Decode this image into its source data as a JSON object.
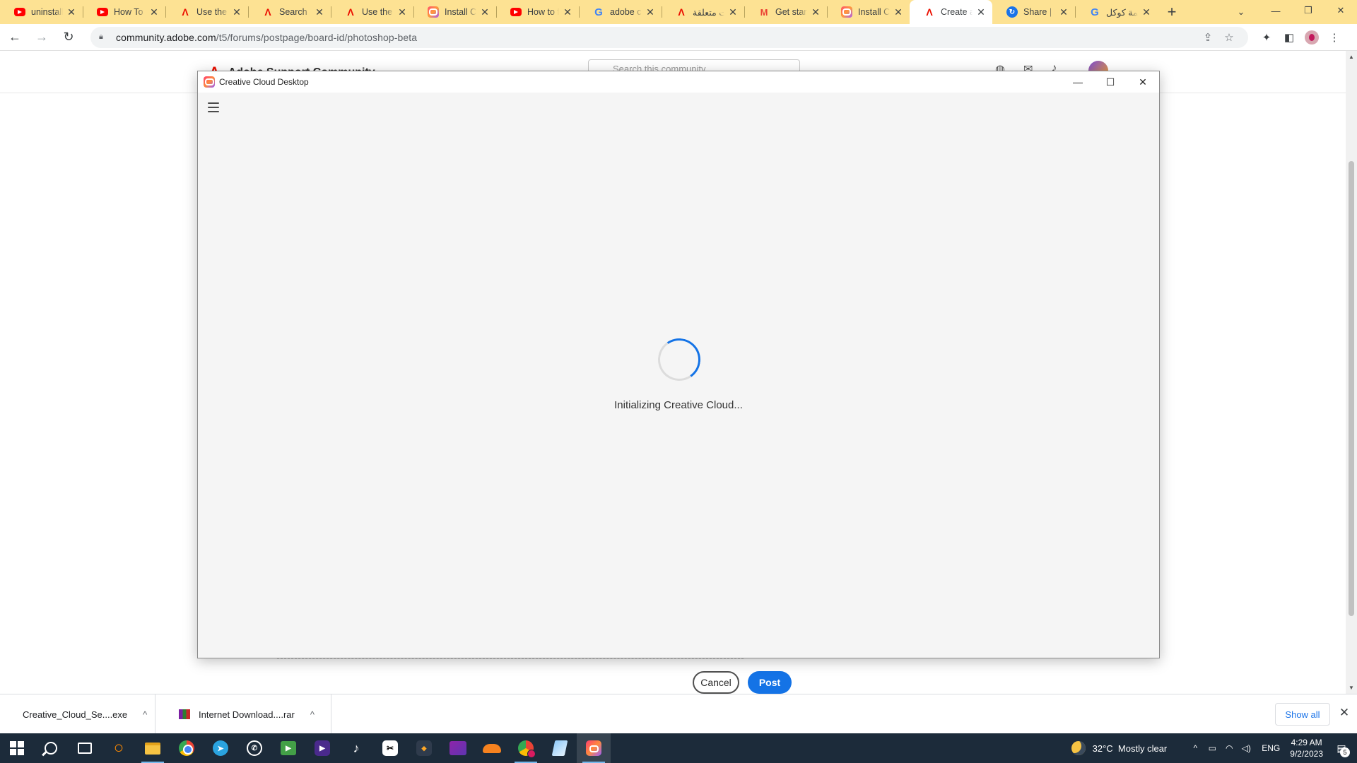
{
  "browser": {
    "tabs": [
      {
        "title": "uninstall a",
        "icon": "youtube-icon",
        "active": false
      },
      {
        "title": "How To U",
        "icon": "youtube-icon",
        "active": false
      },
      {
        "title": "Use the C",
        "icon": "adobe-icon",
        "active": false
      },
      {
        "title": "Search",
        "icon": "adobe-icon",
        "active": false
      },
      {
        "title": "Use the C",
        "icon": "adobe-icon",
        "active": false
      },
      {
        "title": "Install Cre",
        "icon": "creative-cloud-icon",
        "active": false
      },
      {
        "title": "How to fi",
        "icon": "youtube-icon",
        "active": false
      },
      {
        "title": "adobe cre",
        "icon": "google-icon",
        "active": false
      },
      {
        "title": "مشكلات متعلقة",
        "icon": "adobe-icon",
        "active": false
      },
      {
        "title": "Get starte",
        "icon": "gmail-icon",
        "active": false
      },
      {
        "title": "Install Cre",
        "icon": "creative-cloud-icon",
        "active": false
      },
      {
        "title": "Create a p",
        "icon": "adobe-icon",
        "active": true
      },
      {
        "title": "Share | In",
        "icon": "share-icon",
        "active": false
      },
      {
        "title": "ترجمة كوكل",
        "icon": "google-icon",
        "active": false
      }
    ],
    "address": {
      "host": "community.adobe.com",
      "path": "/t5/forums/postpage/board-id/photoshop-beta"
    }
  },
  "page": {
    "site_name": "Adobe Support Community",
    "search_placeholder": "Search this community",
    "cancel_label": "Cancel",
    "post_label": "Post"
  },
  "cc_window": {
    "title": "Creative Cloud Desktop",
    "status": "Initializing Creative Cloud..."
  },
  "downloads": {
    "items": [
      {
        "name": "Creative_Cloud_Se....exe",
        "icon": "creative-cloud-installer-icon"
      },
      {
        "name": "Internet Download....rar",
        "icon": "rar-archive-icon"
      }
    ],
    "show_all_label": "Show all"
  },
  "taskbar": {
    "weather": {
      "temp": "32°C",
      "condition": "Mostly clear"
    },
    "language": "ENG",
    "time": "4:29 AM",
    "date": "9/2/2023",
    "notification_count": "5"
  },
  "colors": {
    "tabstrip": "#fde293",
    "accent_blue": "#1473e6",
    "taskbar": "#1c2b3a"
  }
}
